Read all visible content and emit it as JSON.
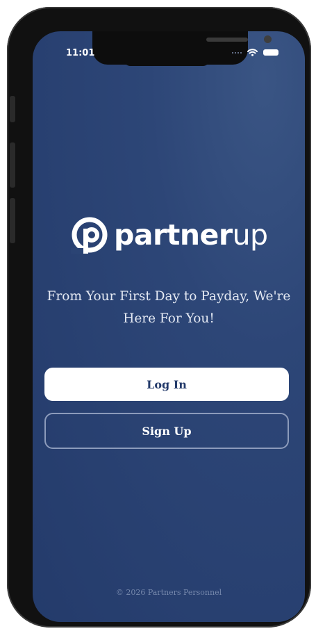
{
  "status_bar": {
    "time": "11:01",
    "signal_icon": "cellular-signal-icon",
    "wifi_icon": "wifi-icon",
    "battery_icon": "battery-icon"
  },
  "logo": {
    "text_bold": "partner",
    "text_light": "up",
    "icon": "partnerup-logo-icon"
  },
  "tagline": "From Your First Day to Payday, We're Here For You!",
  "buttons": {
    "login_label": "Log In",
    "signup_label": "Sign Up"
  },
  "footer": "© 2026 Partners Personnel",
  "colors": {
    "background": "#243b6b",
    "primary_button_bg": "#ffffff",
    "primary_button_text": "#243b6b",
    "outline_button_border": "#8c9bbb"
  }
}
